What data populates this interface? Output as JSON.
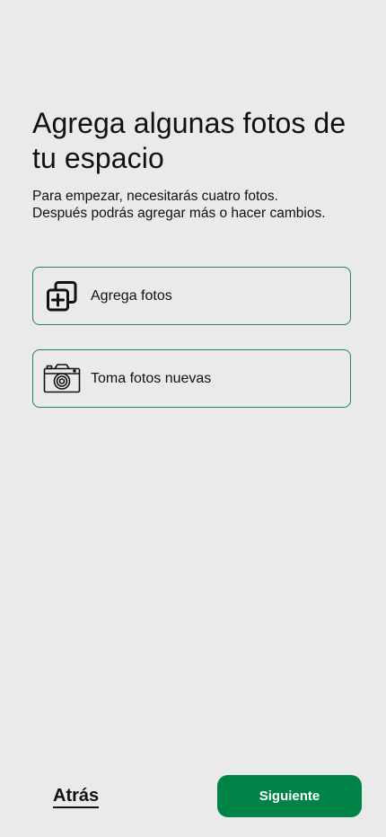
{
  "header": {
    "title": "Agrega algunas fotos de tu espacio",
    "subtitle_line1": "Para empezar, necesitarás cuatro fotos.",
    "subtitle_line2": "Después podrás agregar más o hacer cambios."
  },
  "options": [
    {
      "label": "Agrega fotos",
      "icon": "add-photos-icon"
    },
    {
      "label": "Toma fotos nuevas",
      "icon": "camera-icon"
    }
  ],
  "footer": {
    "back_label": "Atrás",
    "next_label": "Siguiente"
  },
  "colors": {
    "background": "#eaeaea",
    "accent": "#008346",
    "option_border": "#1e8a4c"
  }
}
